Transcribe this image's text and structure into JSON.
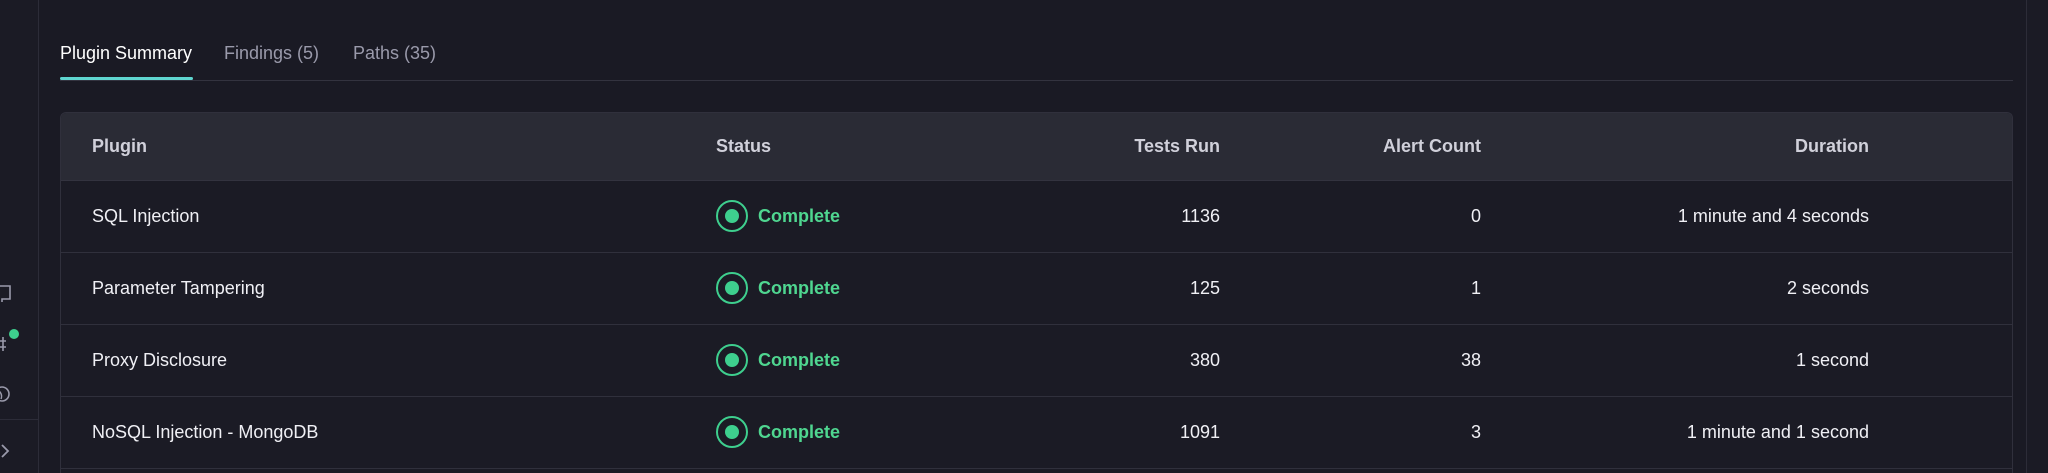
{
  "tabs": [
    {
      "label": "Plugin Summary",
      "active": true
    },
    {
      "label": "Findings (5)",
      "active": false
    },
    {
      "label": "Paths (35)",
      "active": false
    }
  ],
  "table": {
    "headers": {
      "plugin": "Plugin",
      "status": "Status",
      "tests_run": "Tests Run",
      "alert_count": "Alert Count",
      "duration": "Duration"
    },
    "rows": [
      {
        "plugin": "SQL Injection",
        "status": "Complete",
        "tests_run": "1136",
        "alert_count": "0",
        "duration": "1 minute and 4 seconds"
      },
      {
        "plugin": "Parameter Tampering",
        "status": "Complete",
        "tests_run": "125",
        "alert_count": "1",
        "duration": "2 seconds"
      },
      {
        "plugin": "Proxy Disclosure",
        "status": "Complete",
        "tests_run": "380",
        "alert_count": "38",
        "duration": "1 second"
      },
      {
        "plugin": "NoSQL Injection - MongoDB",
        "status": "Complete",
        "tests_run": "1091",
        "alert_count": "3",
        "duration": "1 minute and 1 second"
      }
    ]
  },
  "colors": {
    "accent": "#5fd6d0",
    "status_complete": "#3ecf8e",
    "background": "#1a1a24",
    "header_bg": "#2a2b35"
  },
  "rail_icons": [
    "book-icon",
    "bug-icon",
    "globe-icon",
    "chevron-right-icon"
  ]
}
